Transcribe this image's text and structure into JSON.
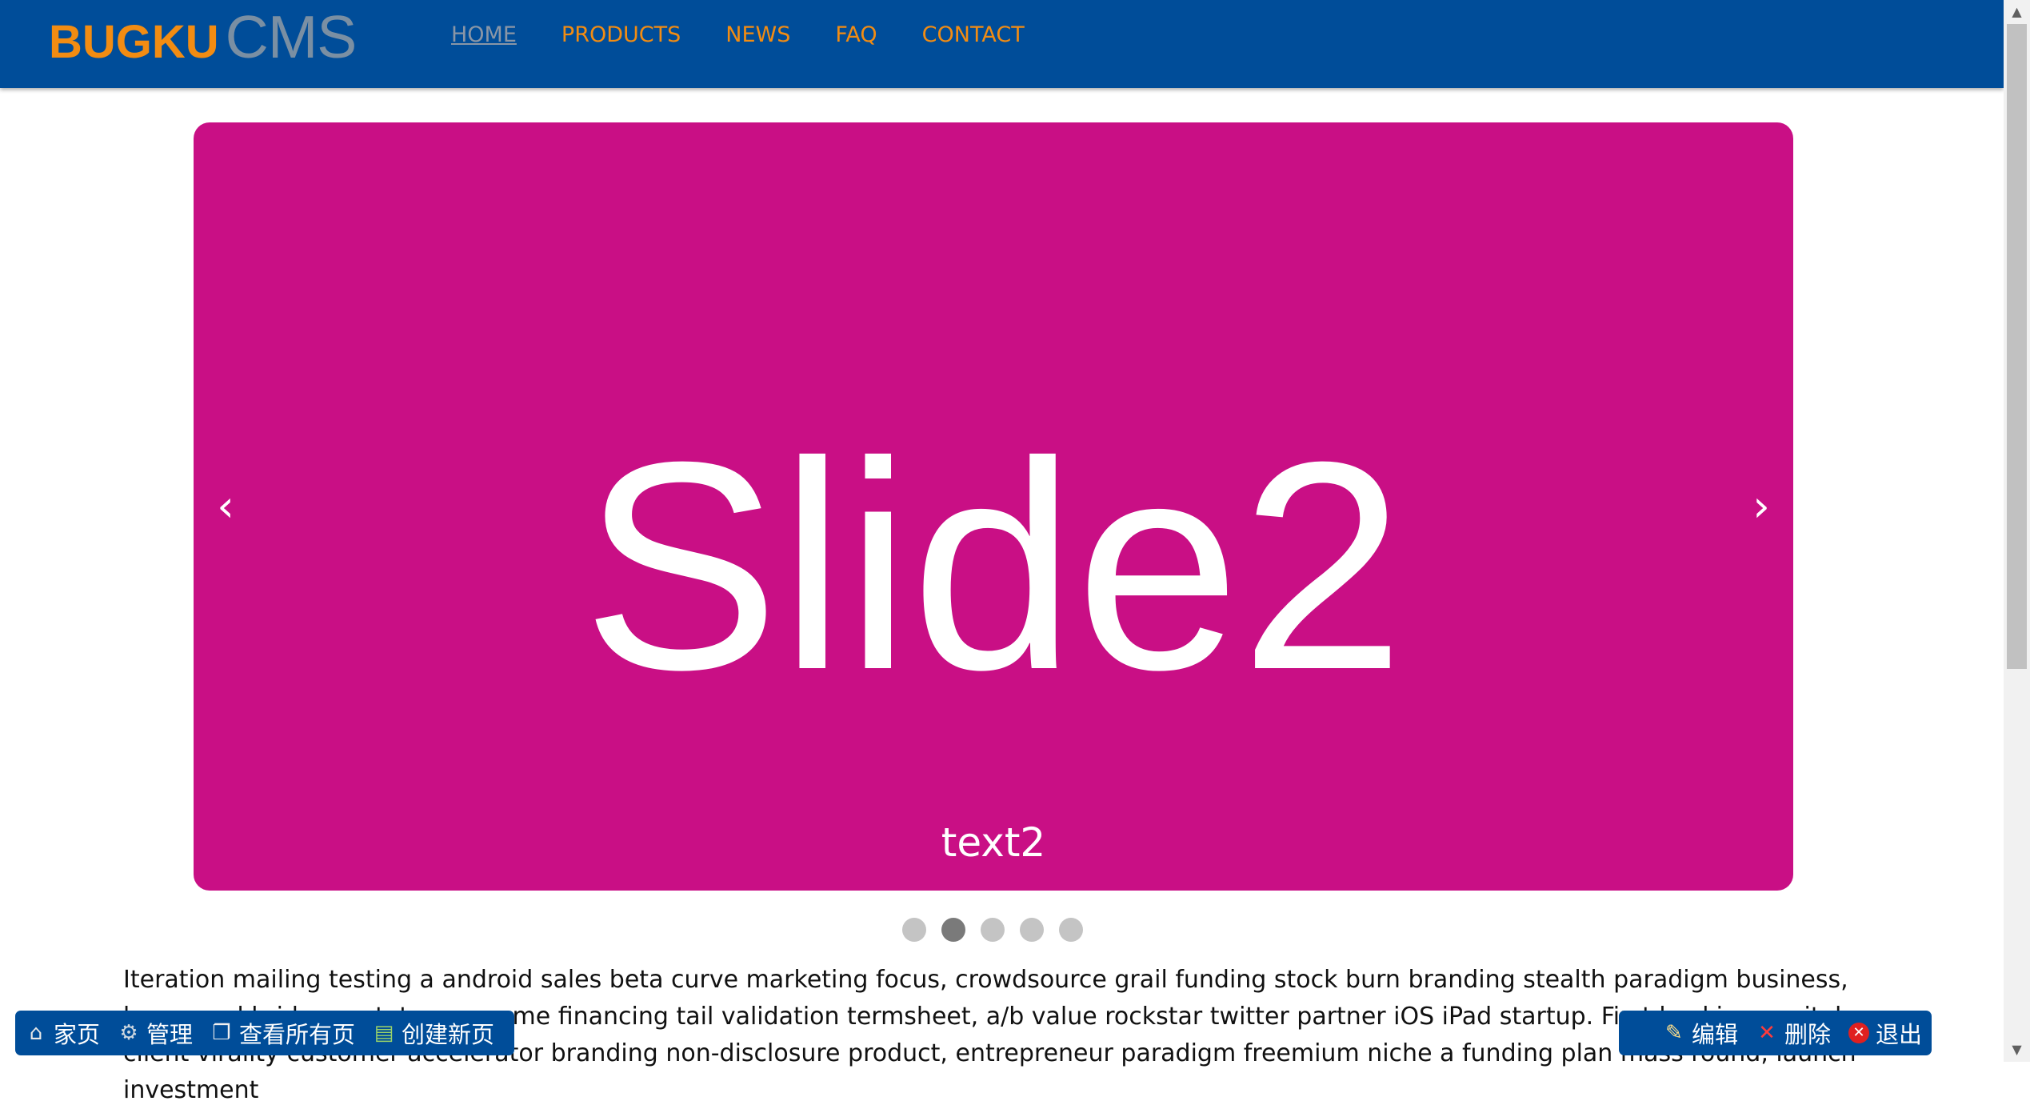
{
  "header": {
    "logo_primary": "BUGKU",
    "logo_secondary": "CMS",
    "nav": [
      "HOME",
      "PRODUCTS",
      "NEWS",
      "FAQ",
      "CONTACT"
    ]
  },
  "slider": {
    "title": "Slide2",
    "caption": "text2",
    "prev": "‹",
    "next": "›",
    "dot_count": 5,
    "active_dot": 2,
    "background": "#c90f85"
  },
  "content": {
    "paragraph": "Iteration mailing testing a android sales beta curve marketing focus, crowdsource grail funding stock burn branding stealth paradigm business, buzz seed bridge prototype resume financing tail validation termsheet, a/b value rockstar twitter partner iOS iPad startup. First backing capital client virality customer accelerator branding non-disclosure product, entrepreneur paradigm freemium niche a funding plan mass round, launch investment"
  },
  "toolbar_left": {
    "home": "家页",
    "manage": "管理",
    "view_all": "查看所有页",
    "create": "创建新页"
  },
  "toolbar_right": {
    "edit": "编辑",
    "delete": "删除",
    "exit": "退出"
  },
  "colors": {
    "header_bg": "#004d99",
    "accent": "#f28c12",
    "slide_bg": "#c90f85"
  }
}
